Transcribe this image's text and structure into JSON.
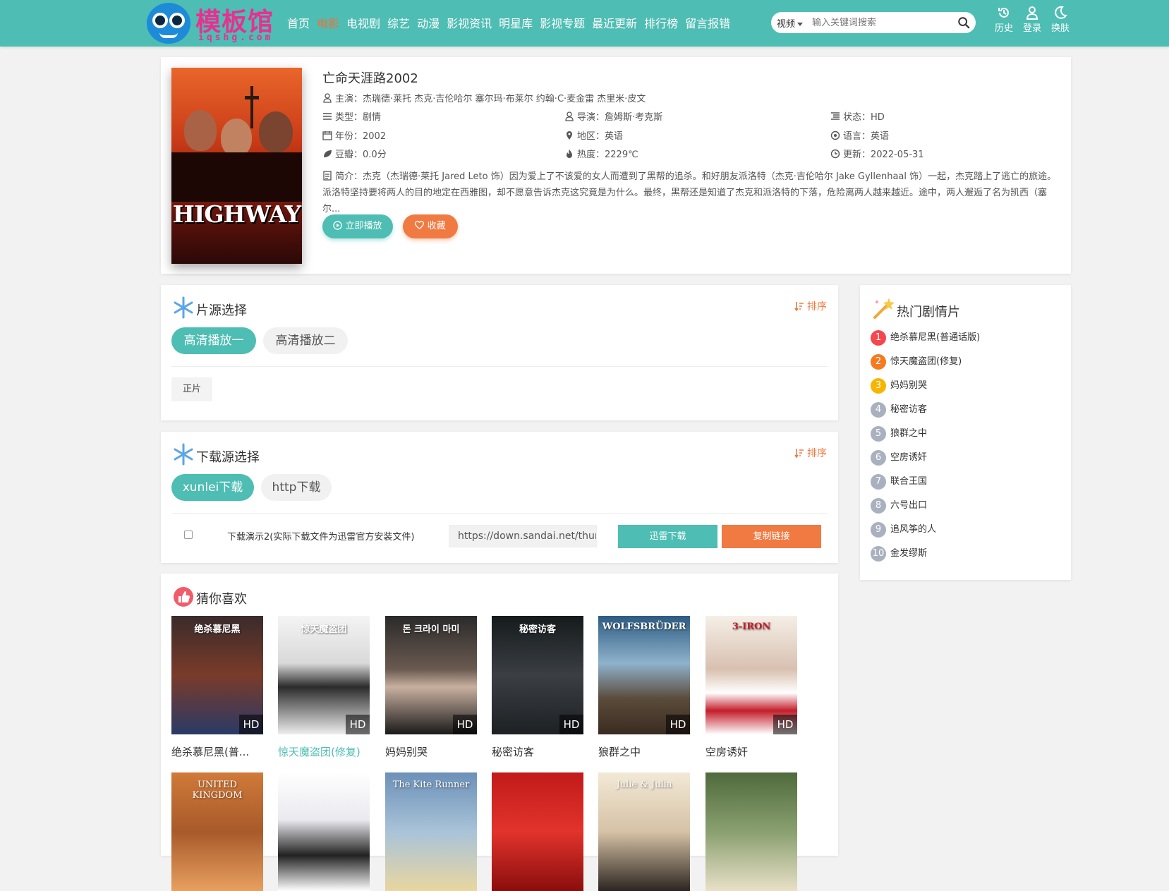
{
  "header": {
    "logo_name": "模板馆",
    "logo_sub": "iqshg.com",
    "nav": [
      {
        "label": "首页",
        "active": false
      },
      {
        "label": "电影",
        "active": true
      },
      {
        "label": "电视剧",
        "active": false
      },
      {
        "label": "综艺",
        "active": false
      },
      {
        "label": "动漫",
        "active": false
      },
      {
        "label": "影视资讯",
        "active": false
      },
      {
        "label": "明星库",
        "active": false
      },
      {
        "label": "影视专题",
        "active": false
      },
      {
        "label": "最近更新",
        "active": false
      },
      {
        "label": "排行榜",
        "active": false
      },
      {
        "label": "留言报错",
        "active": false
      }
    ],
    "search": {
      "type": "视频",
      "placeholder": "输入关键词搜索"
    },
    "tools": {
      "history": "历史",
      "login": "登录",
      "skin": "换肤"
    }
  },
  "detail": {
    "poster_title": "HIGHWAY",
    "title": "亡命天涯路2002",
    "cast_label": "主演：",
    "cast": "杰瑞德·莱托   杰克·吉伦哈尔   塞尔玛·布莱尔   约翰·C·麦金雷   杰里米·皮文",
    "genre_label": "类型：",
    "genre": "剧情",
    "director_label": "导演：",
    "director": "詹姆斯·考克斯",
    "status_label": "状态：",
    "status": "HD",
    "year_label": "年份：",
    "year": "2002",
    "region_label": "地区：",
    "region": "英语",
    "language_label": "语言：",
    "language": "英语",
    "douban_label": "豆瓣：",
    "douban": "0.0分",
    "heat_label": "热度：",
    "heat": "2229℃",
    "update_label": "更新：",
    "update": "2022-05-31",
    "intro_label": "简介：",
    "intro": "杰克（杰瑞德·莱托 Jared Leto 饰）因为爱上了不该爱的女人而遭到了黑帮的追杀。和好朋友派洛特（杰克·吉伦哈尔 Jake Gyllenhaal 饰）一起，杰克踏上了逃亡的旅途。派洛特坚持要将两人的目的地定在西雅图，却不愿意告诉杰克这究竟是为什么。最终，黑帮还是知道了杰克和派洛特的下落，危险离两人越来越近。途中，两人邂逅了名为凯西（塞尔...",
    "play_label": "立即播放",
    "fav_label": "收藏"
  },
  "sources": {
    "title": "片源选择",
    "sort": "排序",
    "tabs": [
      "高清播放一",
      "高清播放二"
    ],
    "episodes": [
      "正片"
    ]
  },
  "downloads": {
    "title": "下载源选择",
    "sort": "排序",
    "tabs": [
      "xunlei下载",
      "http下载"
    ],
    "item_name": "下载演示2(实际下载文件为迅雷官方安装文件)",
    "item_url": "https://down.sandai.net/thunder",
    "xunlei_btn": "迅雷下载",
    "copy_btn": "复制链接"
  },
  "hot": {
    "title": "热门剧情片",
    "items": [
      "绝杀慕尼黑(普通话版)",
      "惊天魔盗团(修复)",
      "妈妈别哭",
      "秘密访客",
      "狼群之中",
      "空房诱奸",
      "联合王国",
      "六号出口",
      "追风筝的人",
      "金发缪斯"
    ],
    "colors": [
      "#f5474d",
      "#f57a20",
      "#f7b500",
      "#a9b0bf",
      "#a9b0bf",
      "#a9b0bf",
      "#a9b0bf",
      "#a9b0bf",
      "#a9b0bf",
      "#a9b0bf"
    ]
  },
  "guess": {
    "title": "猜你喜欢",
    "badge": "HD",
    "row1": [
      "绝杀慕尼黑(普...",
      "惊天魔盗团(修复)",
      "妈妈别哭",
      "秘密访客",
      "狼群之中",
      "空房诱奸"
    ],
    "row1_posters": [
      "绝杀慕尼黑",
      "惊天魔盗团",
      "돈 크라이 마미",
      "秘密访客",
      "WOLFSBRÜDER",
      "3-IRON"
    ],
    "row2_posters": [
      "UNITED KINGDOM",
      "",
      "The Kite Runner",
      "",
      "Julie & Julia",
      ""
    ]
  },
  "colors": {
    "teal": "#4ebdb3",
    "orange": "#f07a42",
    "active_nav": "#f66d36",
    "logo_pink": "#e92f92"
  }
}
